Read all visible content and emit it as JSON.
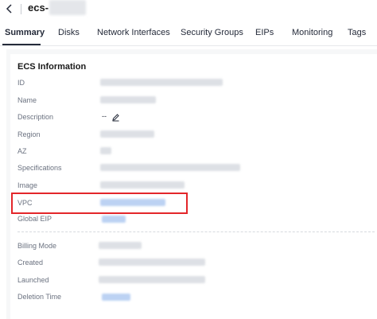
{
  "header": {
    "title": "ecs-",
    "back_icon": "chevron-left-icon"
  },
  "tabs": [
    {
      "label": "Summary",
      "active": true
    },
    {
      "label": "Disks",
      "active": false
    },
    {
      "label": "Network Interfaces",
      "active": false
    },
    {
      "label": "Security Groups",
      "active": false
    },
    {
      "label": "EIPs",
      "active": false
    },
    {
      "label": "Monitoring",
      "active": false
    },
    {
      "label": "Tags",
      "active": false
    }
  ],
  "info": {
    "section_title": "ECS Information",
    "fields": {
      "id": "ID",
      "name": "Name",
      "description": "Description",
      "description_value": "--",
      "region": "Region",
      "az": "AZ",
      "specifications": "Specifications",
      "image": "Image",
      "vpc": "VPC",
      "global_eip": "Global EIP"
    }
  },
  "billing": {
    "fields": {
      "billing_mode": "Billing Mode",
      "created": "Created",
      "launched": "Launched",
      "deletion_time": "Deletion Time"
    }
  },
  "colors": {
    "highlight": "#e3262a",
    "link": "#526ecc"
  }
}
